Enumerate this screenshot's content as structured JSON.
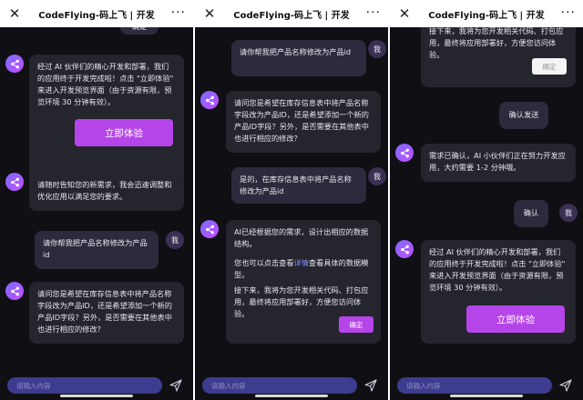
{
  "header": {
    "title": "CodeFlying-码上飞 | 开发",
    "close_glyph": "✕",
    "more_glyph": "···"
  },
  "input": {
    "placeholder": "请输入内容"
  },
  "avatar_user_label": "我",
  "phone1": {
    "top_confirm": "确定",
    "ai1": "经过 AI 伙伴们的精心开发和部署，我们的应用终于开发完成啦！点击 \"立即体验\" 来进入开发预览界面（由于资源有限，预览环境 30 分钟有效）。",
    "cta": "立即体验",
    "ai2": "请随时告知您的新需求，我会迅速调整和优化应用以满足您的要求。",
    "user1": "请你帮我把产品名称修改为产品id",
    "ai3": "请问您是希望在库存信息表中将产品名称字段改为产品ID，还是希望添加一个新的产品ID字段？另外，是否需要在其他表中也进行相应的修改？"
  },
  "phone2": {
    "user1": "请你帮我把产品名称修改为产品id",
    "ai1": "请问您是希望在库存信息表中将产品名称字段改为产品ID，还是希望添加一个新的产品ID字段？另外，是否需要在其他表中也进行相应的修改？",
    "user2": "是的，在库存信息表中将产品名称修改为产品id",
    "ai2_p1": "AI已经根据您的需求，设计出相应的数据结构。",
    "ai2_p2a": "您也可以点击查看",
    "ai2_link": "详情",
    "ai2_p2b": "查看具体的数据模型。",
    "ai2_p3": "接下来，我将为您开发相关代码、打包应用，最终将应用部署好，方便您访问体验。",
    "confirm": "确定"
  },
  "phone3": {
    "ai_top": "接下来，我将为您开发相关代码、打包应用，最终将应用部署好，方便您访问体验。",
    "confirm_disabled": "确定",
    "user1": "确认发送",
    "ai2": "需求已确认，AI 小伙伴们正在努力开发应用，大约需要 1-2 分钟哦。",
    "user2": "确认",
    "ai3": "经过 AI 伙伴们的精心开发和部署，我们的应用终于开发完成啦！点击 \"立即体验\" 来进入开发预览界面（由于资源有限，预览环境 30 分钟有效）。",
    "cta": "立即体验"
  },
  "colors": {
    "accent": "#b545e8",
    "background": "#0f0f14",
    "bubble_ai": "#25252e",
    "input_bg": "#3e3c8e"
  }
}
